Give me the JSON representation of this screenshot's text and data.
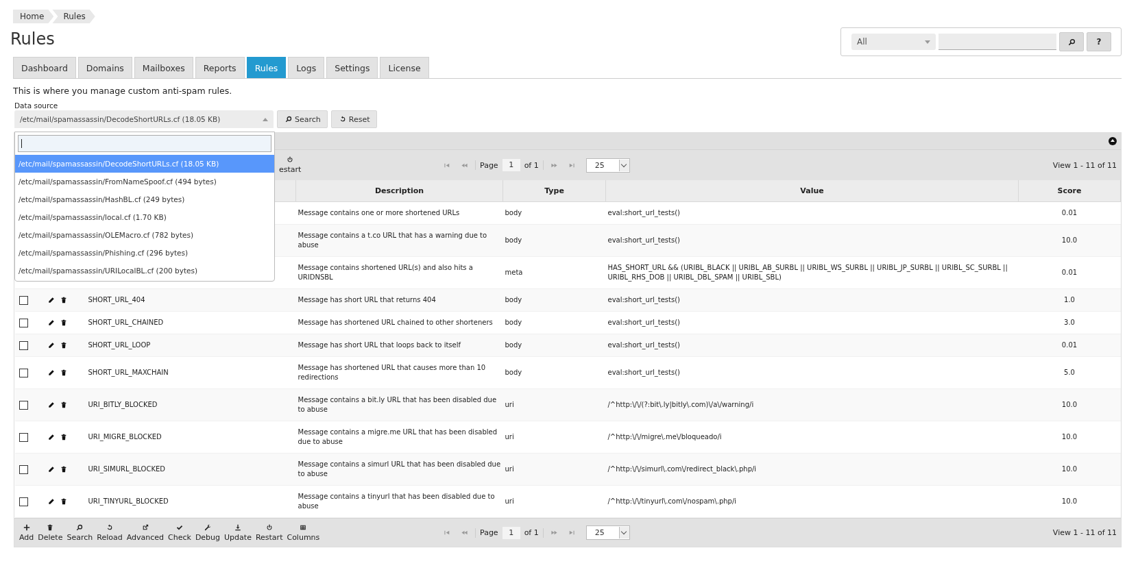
{
  "breadcrumb": [
    {
      "label": "Home"
    },
    {
      "label": "Rules"
    }
  ],
  "page_title": "Rules",
  "search_panel": {
    "filter": "All",
    "help_button": "?"
  },
  "tabs": [
    {
      "label": "Dashboard",
      "selected": false
    },
    {
      "label": "Domains",
      "selected": false
    },
    {
      "label": "Mailboxes",
      "selected": false
    },
    {
      "label": "Reports",
      "selected": false
    },
    {
      "label": "Rules",
      "selected": true
    },
    {
      "label": "Logs",
      "selected": false
    },
    {
      "label": "Settings",
      "selected": false
    },
    {
      "label": "License",
      "selected": false
    }
  ],
  "intro": "This is where you manage custom anti-spam rules.",
  "data_source": {
    "label": "Data source",
    "value": "/etc/mail/spamassassin/DecodeShortURLs.cf (18.05 KB)",
    "search_button": "Search",
    "reset_button": "Reset",
    "dropdown": {
      "expanded": true,
      "options": [
        {
          "label": "/etc/mail/spamassassin/DecodeShortURLs.cf (18.05 KB)",
          "selected": true
        },
        {
          "label": "/etc/mail/spamassassin/FromNameSpoof.cf (494 bytes)",
          "selected": false
        },
        {
          "label": "/etc/mail/spamassassin/HashBL.cf (249 bytes)",
          "selected": false
        },
        {
          "label": "/etc/mail/spamassassin/local.cf (1.70 KB)",
          "selected": false
        },
        {
          "label": "/etc/mail/spamassassin/OLEMacro.cf (782 bytes)",
          "selected": false
        },
        {
          "label": "/etc/mail/spamassassin/Phishing.cf (296 bytes)",
          "selected": false
        },
        {
          "label": "/etc/mail/spamassassin/URILocalBL.cf (200 bytes)",
          "selected": false
        }
      ]
    }
  },
  "grid": {
    "top_toolbar": [
      {
        "kind": "restart",
        "label": "estart"
      }
    ],
    "top_pager": {
      "page_label": "Page",
      "page": "1",
      "of": "of 1",
      "page_size": "25",
      "view": "View 1 - 11 of 11"
    },
    "columns": [
      "Description",
      "Type",
      "Value",
      "Score"
    ],
    "rows": [
      {
        "description": "Message contains one or more shortened URLs",
        "type": "body",
        "value": "eval:short_url_tests()",
        "score": "0.01"
      },
      {
        "description": "Message contains a t.co URL that has a warning due to abuse",
        "type": "body",
        "value": "eval:short_url_tests()",
        "score": "10.0"
      },
      {
        "description": "Message contains shortened URL(s) and also hits a URIDNSBL",
        "type": "meta",
        "value": "HAS_SHORT_URL && (URIBL_BLACK || URIBL_AB_SURBL || URIBL_WS_SURBL || URIBL_JP_SURBL || URIBL_SC_SURBL || URIBL_RHS_DOB || URIBL_DBL_SPAM || URIBL_SBL)",
        "score": "0.01"
      },
      {
        "checked": false,
        "name": "SHORT_URL_404",
        "description": "Message has short URL that returns 404",
        "type": "body",
        "value": "eval:short_url_tests()",
        "score": "1.0"
      },
      {
        "checked": false,
        "name": "SHORT_URL_CHAINED",
        "description": "Message has shortened URL chained to other shorteners",
        "type": "body",
        "value": "eval:short_url_tests()",
        "score": "3.0"
      },
      {
        "checked": false,
        "name": "SHORT_URL_LOOP",
        "description": "Message has short URL that loops back to itself",
        "type": "body",
        "value": "eval:short_url_tests()",
        "score": "0.01"
      },
      {
        "checked": false,
        "name": "SHORT_URL_MAXCHAIN",
        "description": "Message has shortened URL that causes more than 10 redirections",
        "type": "body",
        "value": "eval:short_url_tests()",
        "score": "5.0"
      },
      {
        "checked": false,
        "name": "URI_BITLY_BLOCKED",
        "description": "Message contains a bit.ly URL that has been disabled due to abuse",
        "type": "uri",
        "value": "/^http:\\/\\/(?:bit\\.ly|bitly\\.com)\\/a\\/warning/i",
        "score": "10.0"
      },
      {
        "checked": false,
        "name": "URI_MIGRE_BLOCKED",
        "description": "Message contains a migre.me URL that has been disabled due to abuse",
        "type": "uri",
        "value": "/^http:\\/\\/migre\\.me\\/bloqueado/i",
        "score": "10.0"
      },
      {
        "checked": false,
        "name": "URI_SIMURL_BLOCKED",
        "description": "Message contains a simurl URL that has been disabled due to abuse",
        "type": "uri",
        "value": "/^http:\\/\\/simurl\\.com\\/redirect_black\\.php/i",
        "score": "10.0"
      },
      {
        "checked": false,
        "name": "URI_TINYURL_BLOCKED",
        "description": "Message contains a tinyurl that has been disabled due to abuse",
        "type": "uri",
        "value": "/^http:\\/\\/tinyurl\\.com\\/nospam\\.php/i",
        "score": "10.0"
      }
    ],
    "bottom_toolbar": [
      {
        "kind": "add",
        "label": "Add"
      },
      {
        "kind": "delete",
        "label": "Delete"
      },
      {
        "kind": "search",
        "label": "Search"
      },
      {
        "kind": "reload",
        "label": "Reload"
      },
      {
        "kind": "advanced",
        "label": "Advanced"
      },
      {
        "kind": "check",
        "label": "Check"
      },
      {
        "kind": "debug",
        "label": "Debug"
      },
      {
        "kind": "update",
        "label": "Update"
      },
      {
        "kind": "restart",
        "label": "Restart"
      },
      {
        "kind": "columns",
        "label": "Columns"
      }
    ],
    "bottom_pager": {
      "page_label": "Page",
      "page": "1",
      "of": "of 1",
      "page_size": "25",
      "view": "View 1 - 11 of 11"
    }
  }
}
